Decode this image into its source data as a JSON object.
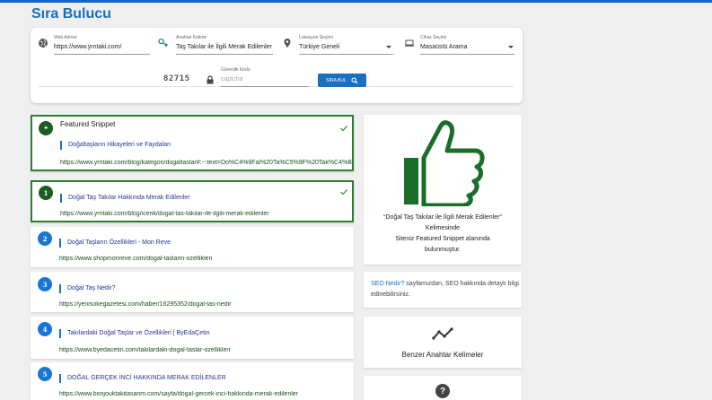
{
  "page_title": "Sıra Bulucu",
  "form": {
    "website": {
      "label": "Web Adresi",
      "value": "https://www.yrntaki.com/"
    },
    "keyword": {
      "label": "Anahtar Kelime",
      "value": "Taş Takılar ile İlgili Merak Edilenler"
    },
    "location": {
      "label": "Lokasyon Seçimi",
      "value": "Türkiye Geneli"
    },
    "device": {
      "label": "Cihaz Seçimi",
      "value": "Masaüstü Arama"
    },
    "captcha": {
      "label": "Güvenlik Kodu",
      "placeholder": "captcha",
      "image_text": "82715"
    },
    "search_button": "SIRA BUL"
  },
  "featured_snippet": {
    "label": "Featured Snippet",
    "title": "Doğaltaşların Hikayeleri ve Faydaları",
    "url": "https://www.yrntaki.com/blog/kategori/dogaltaslar#:~:text=Do%C4%9Fal%20Ta%C5%9F%20Tak%C4%B1"
  },
  "results": [
    {
      "rank": "1",
      "title": "Doğal Taş Takılar Hakkında Merak Edilenler",
      "url": "https://www.yrntaki.com/blog/icerik/dogal-tas-takilar-ile-ilgili-merak-edilenler"
    },
    {
      "rank": "2",
      "title": "Doğal Taşların Özellikleri - Mon Reve",
      "url": "https://www.shopmonreve.com/dogal-taslarin-ozellikleri"
    },
    {
      "rank": "3",
      "title": "Doğal Taş Nedir?",
      "url": "https://yenisokegazetesi.com/haber/16295352/dogal-tas-nedir"
    },
    {
      "rank": "4",
      "title": "Takılardaki Doğal Taşlar ve Özellikleri | ByEdaÇetin",
      "url": "https://www.byedacetin.com/takilardaki-dogal-taslar-ozellikleri"
    },
    {
      "rank": "5",
      "title": "DOĞAL GERÇEK İNCİ HAKKINDA MERAK EDİLENLER",
      "url": "https://www.bonjouktakitasarim.com/sayfa/dogal-gercek-inci-hakkinda-merak-edilenler"
    }
  ],
  "sidebar": {
    "thumbs": {
      "line1": "“Doğal Taş Takılar ile İlgili Merak Edilenler”",
      "line2": "Kelimesinde",
      "line3": "Siteniz Featured Snippet alanında",
      "line4": "bulunmuştur."
    },
    "seo": {
      "link": "SEO Nedir?",
      "rest": " sayfamızdan, SEO hakkında detaylı bilgi edinebilirsiniz."
    },
    "similar_keywords": "Benzer Anahtar Kelimeler"
  },
  "colors": {
    "primary": "#1a6fbf",
    "highlight_green": "#2e7d32",
    "thumb_green": "#1b6e2a"
  }
}
